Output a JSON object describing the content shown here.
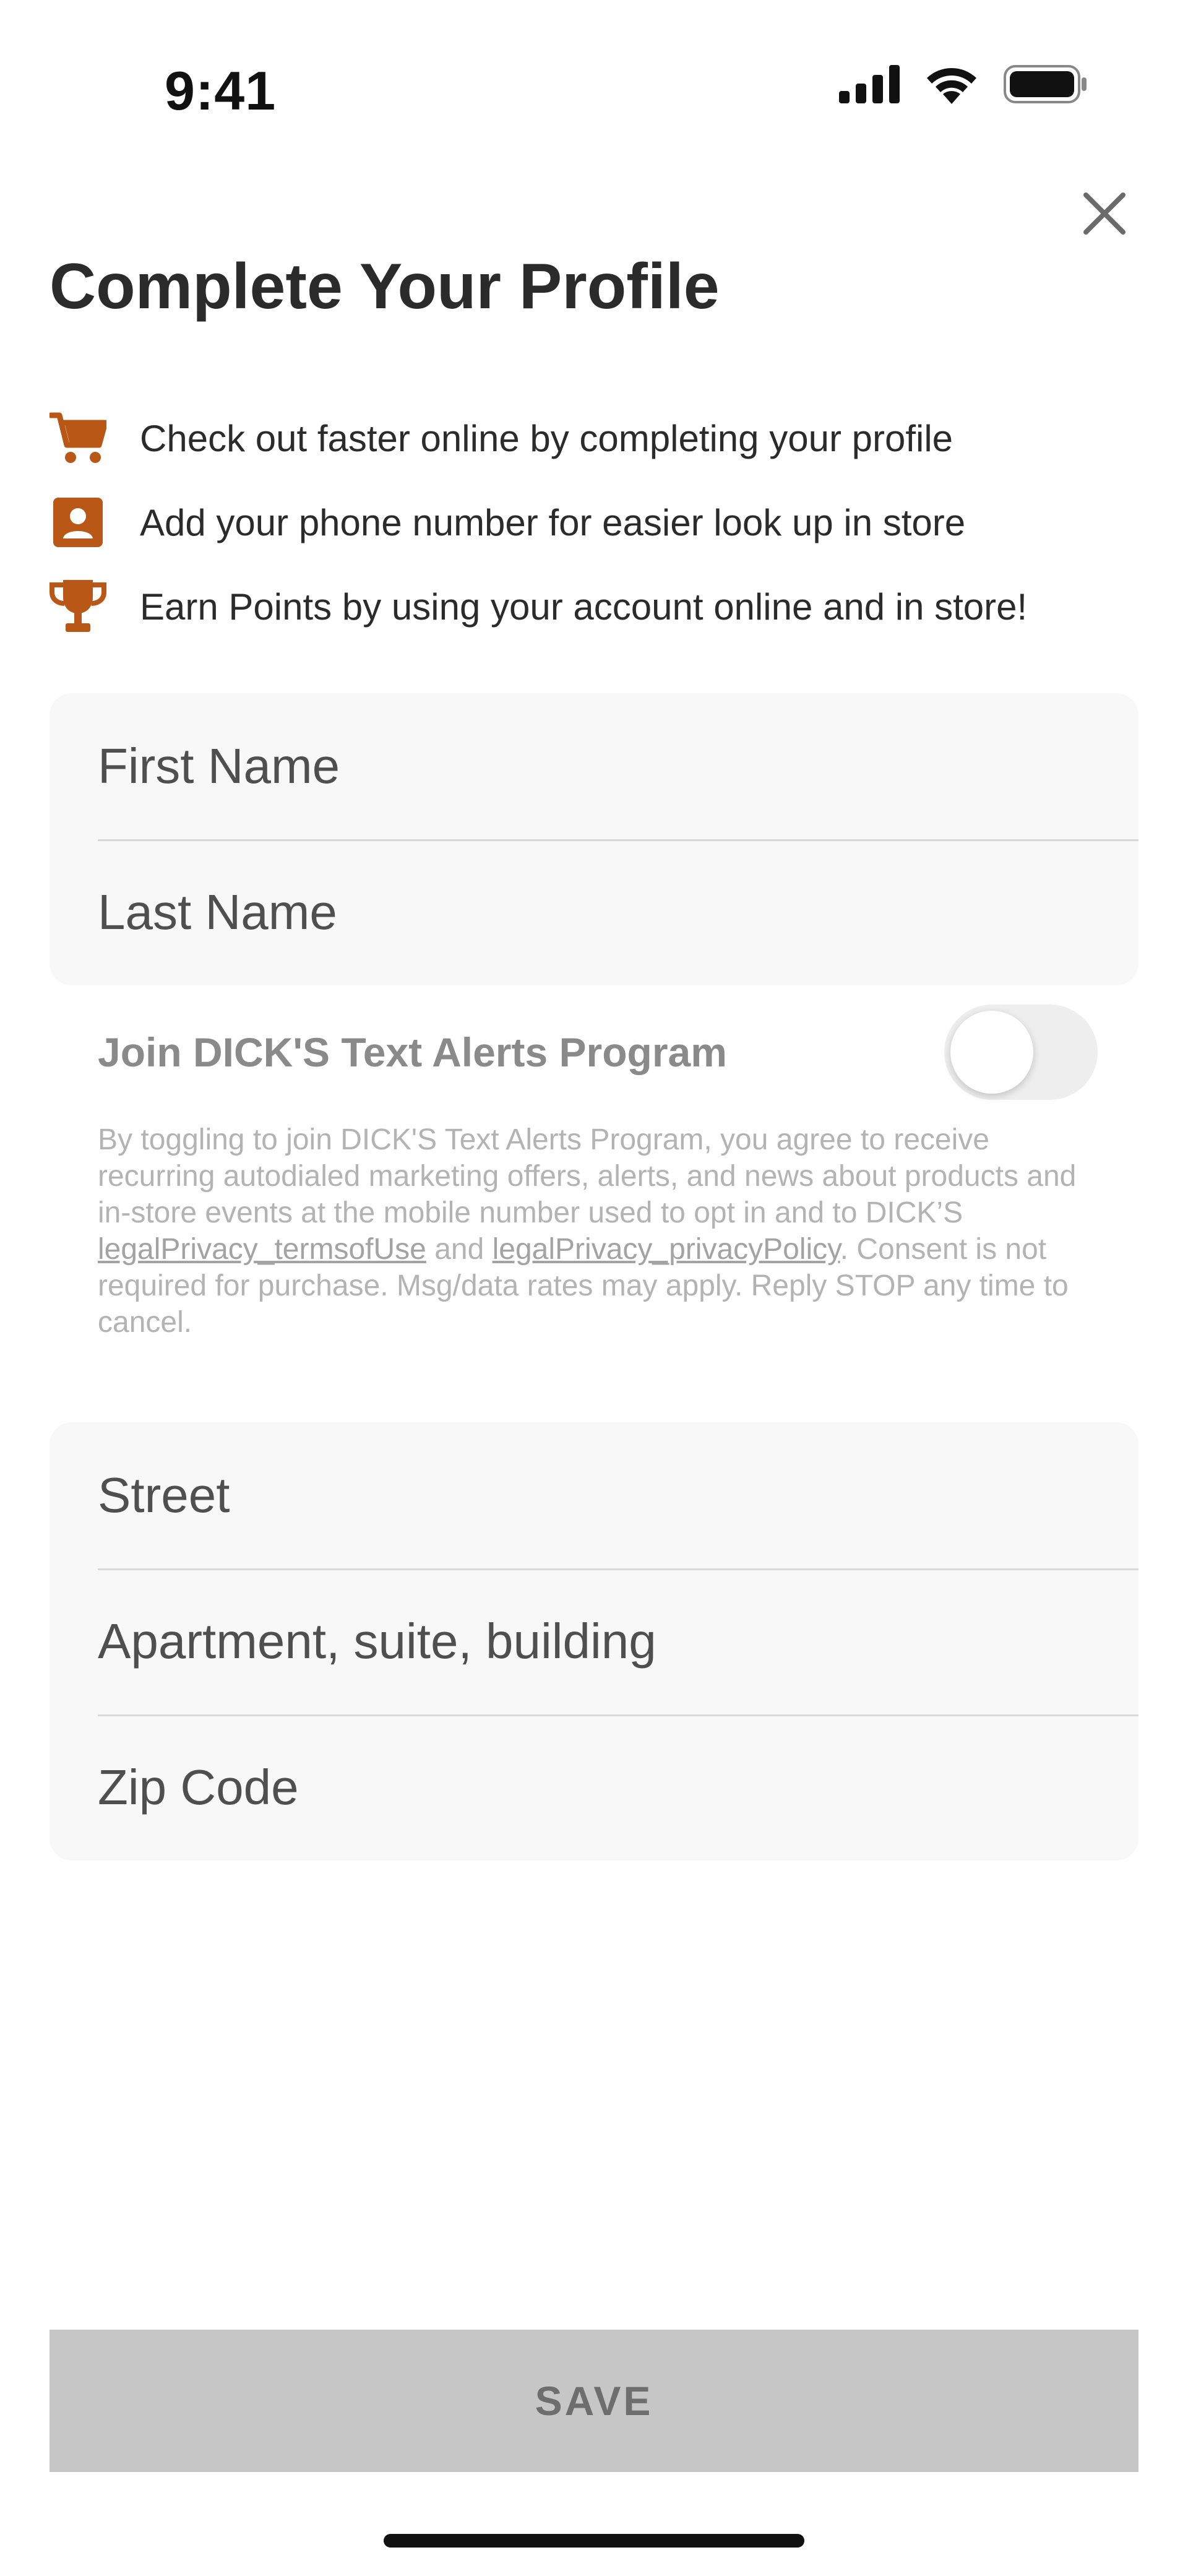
{
  "status_bar": {
    "time": "9:41"
  },
  "header": {
    "title": "Complete Your Profile",
    "close_icon": "close-icon"
  },
  "benefits": [
    {
      "icon": "cart-icon",
      "text": "Check out faster online by completing your profile"
    },
    {
      "icon": "contact-card-icon",
      "text": "Add your phone number for easier look up in store"
    },
    {
      "icon": "trophy-icon",
      "text": "Earn Points by using your account online and in store!"
    }
  ],
  "name_fields": {
    "first_name": {
      "placeholder": "First Name",
      "value": ""
    },
    "last_name": {
      "placeholder": "Last Name",
      "value": ""
    }
  },
  "text_alerts": {
    "label": "Join DICK'S Text Alerts Program",
    "enabled": false,
    "disclaimer_before": "By toggling to join DICK'S Text Alerts Program, you agree to receive recurring autodialed marketing offers, alerts, and news about products and in-store events at the mobile number used to opt in and to DICK’S ",
    "terms_link": "legalPrivacy_termsofUse",
    "disclaimer_and": " and ",
    "privacy_link": "legalPrivacy_privacyPolicy",
    "disclaimer_after": ". Consent is not required for purchase. Msg/data rates may apply. Reply STOP any time to cancel."
  },
  "address_fields": {
    "street": {
      "placeholder": "Street",
      "value": ""
    },
    "apartment": {
      "placeholder": "Apartment, suite, building",
      "value": ""
    },
    "zip": {
      "placeholder": "Zip Code",
      "value": ""
    }
  },
  "footer": {
    "save_label": "SAVE"
  },
  "colors": {
    "accent_icon": "#b85716",
    "title_text": "#2b2b2b",
    "field_background": "#f8f8f8",
    "save_button_disabled": "#c6c6c6"
  }
}
